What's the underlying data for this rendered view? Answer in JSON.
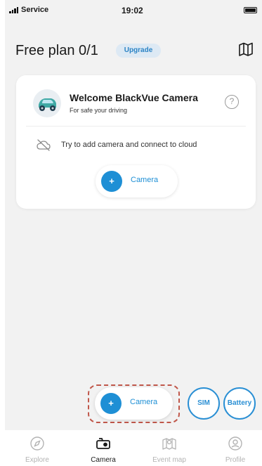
{
  "status_bar": {
    "carrier": "Service",
    "time": "19:02"
  },
  "header": {
    "title": "Free plan 0/1",
    "upgrade_label": "Upgrade",
    "map_icon": "map-icon"
  },
  "welcome_card": {
    "title": "Welcome BlackVue Camera",
    "subtitle": "For safe your driving",
    "empty_message": "Try to add camera and connect to cloud",
    "camera_button_label": "Camera",
    "plus_symbol": "+"
  },
  "floating_actions": {
    "camera_label": "Camera",
    "plus_symbol": "+",
    "sim_label": "SIM",
    "battery_label": "Battery",
    "highlight_color": "#c0574a"
  },
  "tabs": [
    {
      "label": "Explore",
      "icon": "compass-icon",
      "active": false
    },
    {
      "label": "Camera",
      "icon": "camera-icon",
      "active": true
    },
    {
      "label": "Event map",
      "icon": "event-map-icon",
      "active": false
    },
    {
      "label": "Profile",
      "icon": "profile-icon",
      "active": false
    }
  ],
  "colors": {
    "accent": "#1e8fd5",
    "background": "#f2f2f2",
    "upgrade_bg": "#dde9f4",
    "inactive_tab": "#b3b3b3"
  }
}
